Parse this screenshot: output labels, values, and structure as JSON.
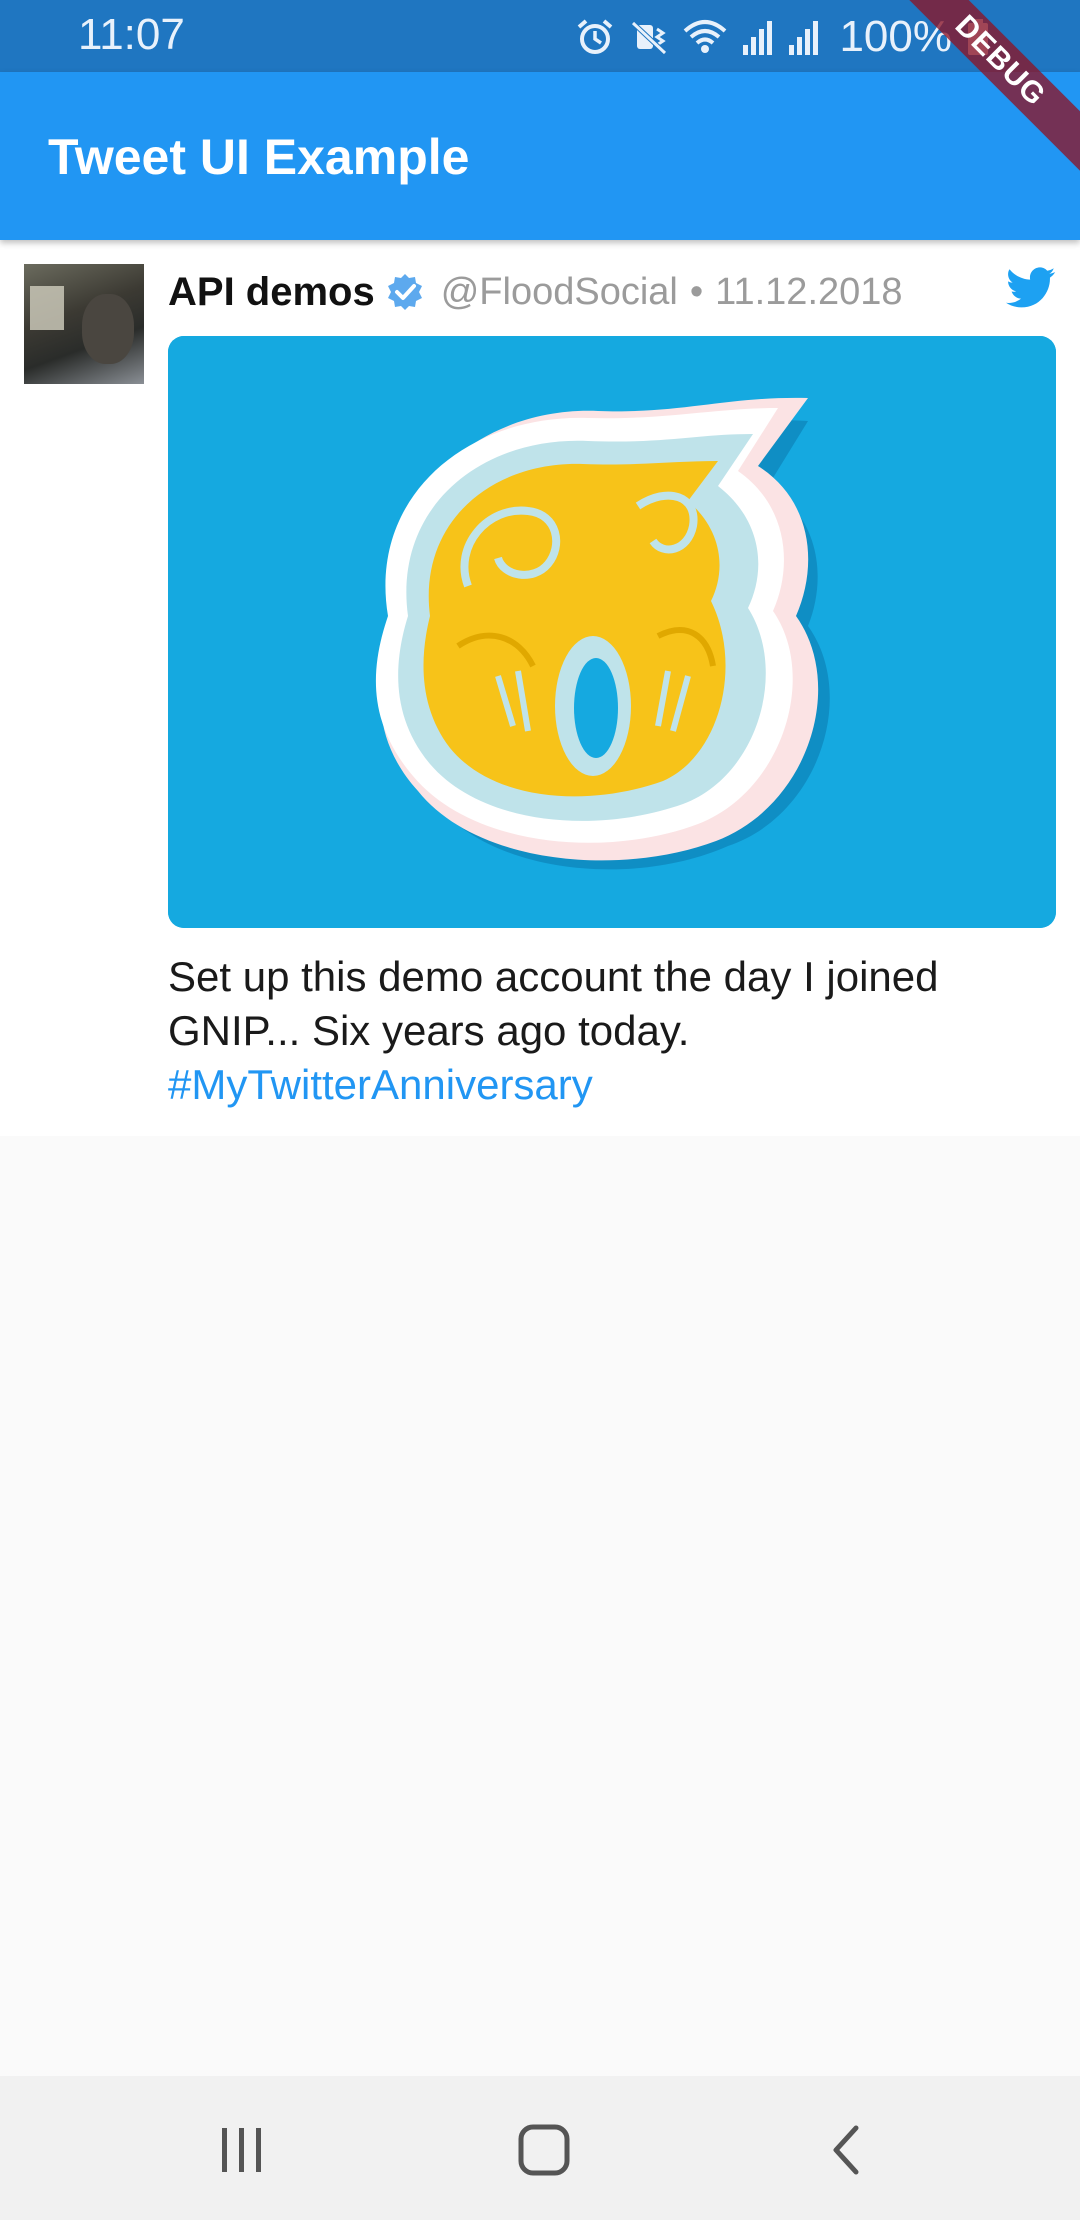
{
  "status_bar": {
    "time": "11:07",
    "battery": "100%",
    "icons": [
      "alarm-icon",
      "mute-vibrate-icon",
      "wifi-icon",
      "signal-icon",
      "signal-icon",
      "battery-icon"
    ]
  },
  "debug_banner": "DEBUG",
  "app_bar": {
    "title": "Tweet UI Example"
  },
  "tweet": {
    "user_name": "API demos",
    "handle": "@FloodSocial",
    "separator": "•",
    "date": "11.12.2018",
    "verified": true,
    "text": "Set up this demo account the day I joined GNIP... Six years ago today.",
    "hashtag": "#MyTwitterAnniversary",
    "media_description": "six-paper-cutout-image"
  },
  "nav_bar": {
    "buttons": [
      "recent-apps-icon",
      "home-icon",
      "back-icon"
    ]
  },
  "colors": {
    "status_bar": "#1f76c1",
    "app_bar": "#2196f3",
    "twitter_blue": "#1da1f2",
    "hashtag": "#2196f3",
    "background": "#fafafa"
  }
}
